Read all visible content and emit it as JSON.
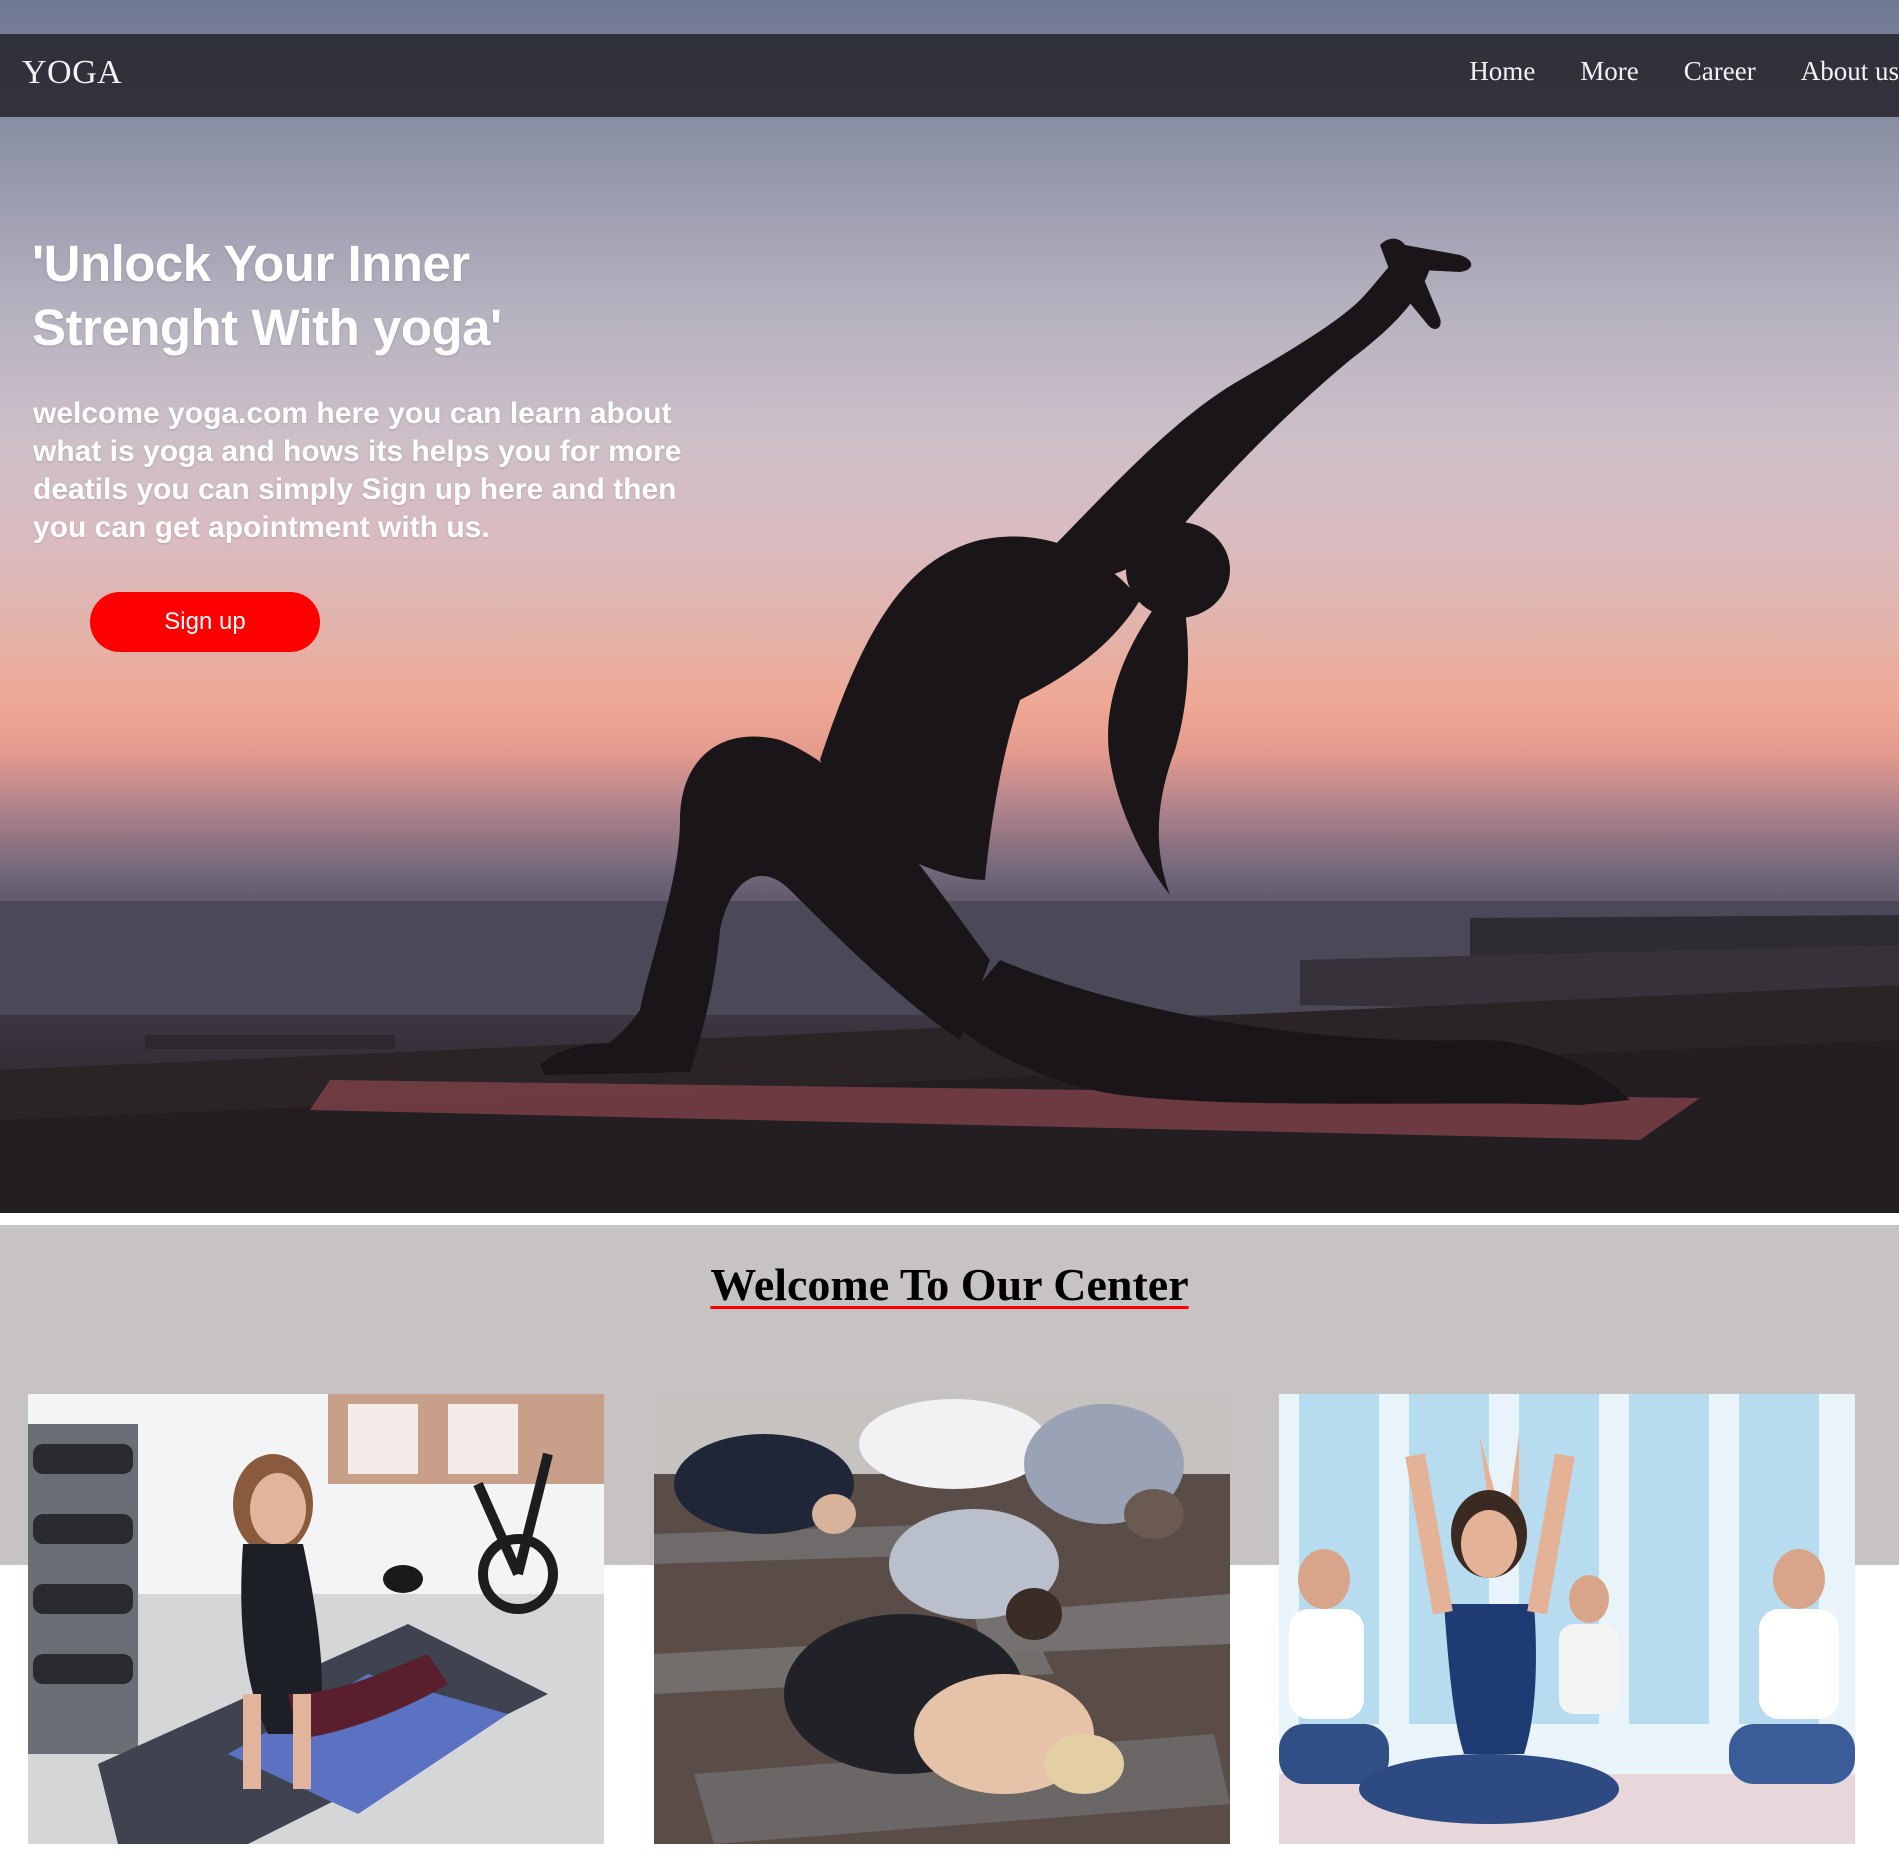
{
  "nav": {
    "brand": "YOGA",
    "links": [
      "Home",
      "More",
      "Career",
      "About us"
    ]
  },
  "hero": {
    "title_line1": "'Unlock Your Inner",
    "title_line2": "Strenght With yoga'",
    "text_line1": "welcome yoga.com here you can learn about",
    "text_line2": "what is yoga and hows its helps you for more",
    "text_line3": "deatils you can simply Sign up here and then",
    "text_line4": "you can get apointment with us.",
    "cta_label": "Sign up"
  },
  "section": {
    "title": "Welcome To Our Center"
  },
  "colors": {
    "accent": "#ff0000",
    "navbar": "#26262c",
    "section_bg": "#c7c3c5"
  }
}
